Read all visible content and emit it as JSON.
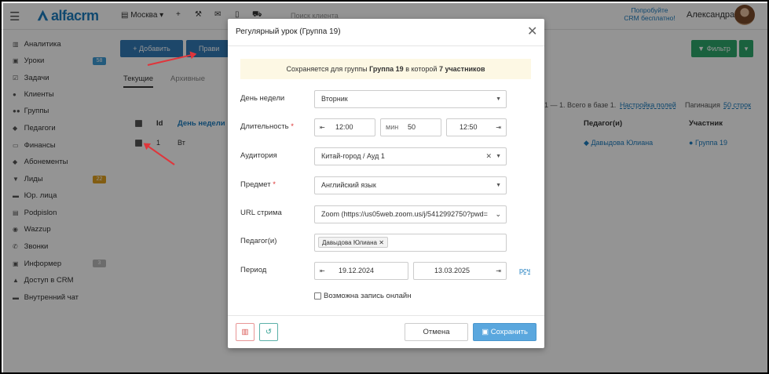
{
  "topbar": {
    "logo_text": "alfacrm",
    "branch": "Москва",
    "search_placeholder": "Поиск клиента",
    "promo_line1": "Попробуйте",
    "promo_line2": "CRM бесплатно!",
    "user_name": "Александра"
  },
  "sidebar": {
    "items": [
      {
        "label": "Аналитика",
        "icon": "chart-icon"
      },
      {
        "label": "Уроки",
        "icon": "calendar-icon",
        "badge": "58"
      },
      {
        "label": "Задачи",
        "icon": "tasks-icon"
      },
      {
        "label": "Клиенты",
        "icon": "user-icon"
      },
      {
        "label": "Группы",
        "icon": "users-icon"
      },
      {
        "label": "Педагоги",
        "icon": "graduation-cap-icon"
      },
      {
        "label": "Финансы",
        "icon": "money-icon"
      },
      {
        "label": "Абонементы",
        "icon": "tag-icon"
      },
      {
        "label": "Лиды",
        "icon": "funnel-icon",
        "badge": "22"
      },
      {
        "label": "Юр. лица",
        "icon": "briefcase-icon"
      },
      {
        "label": "Podpislon",
        "icon": "document-icon"
      },
      {
        "label": "Wazzup",
        "icon": "whatsapp-icon"
      },
      {
        "label": "Звонки",
        "icon": "phone-icon"
      },
      {
        "label": "Информер",
        "icon": "inbox-icon",
        "badge": "3"
      },
      {
        "label": "Доступ в CRM",
        "icon": "lock-icon"
      },
      {
        "label": "Внутренний чат",
        "icon": "chat-icon"
      }
    ]
  },
  "main": {
    "add_button": "+ Добавить",
    "edit_button": "Прави",
    "filter_button": "Фильтр",
    "tabs": [
      "Текущие",
      "Архивные"
    ],
    "pagination_info": "1 — 1. Всего в базе 1.",
    "settings_link": "Настройка полей",
    "pagination_label": "Пагинация",
    "pagination_value": "50 строк",
    "columns": {
      "id": "Id",
      "weekday": "День недели",
      "teacher": "Педагог(и)",
      "participant": "Участник"
    },
    "row": {
      "id": "1",
      "weekday": "Вт",
      "teacher": "Давыдова Юлиана",
      "participant": "Группа 19"
    }
  },
  "modal": {
    "title": "Регулярный урок (Группа 19)",
    "notice_prefix": "Сохраняется для группы",
    "notice_group": "Группа 19",
    "notice_middle": "в которой",
    "notice_count": "7 участников",
    "weekday_label": "День недели",
    "weekday_value": "Вторник",
    "duration_label": "Длительность",
    "start_time": "12:00",
    "minutes_label": "мин",
    "minutes_value": "50",
    "end_time": "12:50",
    "room_label": "Аудитория",
    "room_value": "Китай-город / Ауд 1",
    "subject_label": "Предмет",
    "subject_value": "Английский язык",
    "stream_label": "URL стрима",
    "stream_value": "Zoom (https://us05web.zoom.us/j/5412992750?pwd=",
    "teacher_label": "Педагог(и)",
    "teacher_value": "Давыдова Юлиана",
    "period_label": "Период",
    "period_start": "19.12.2024",
    "period_end": "13.03.2025",
    "period_link": "рсч",
    "online_label": "Возможна запись онлайн",
    "cancel_button": "Отмена",
    "save_button": "Сохранить"
  },
  "colors": {
    "accent": "#1d7dbf",
    "save": "#5aa7de",
    "filter": "#2ea86b",
    "add": "#337ab7",
    "arrow": "#e0353b"
  }
}
